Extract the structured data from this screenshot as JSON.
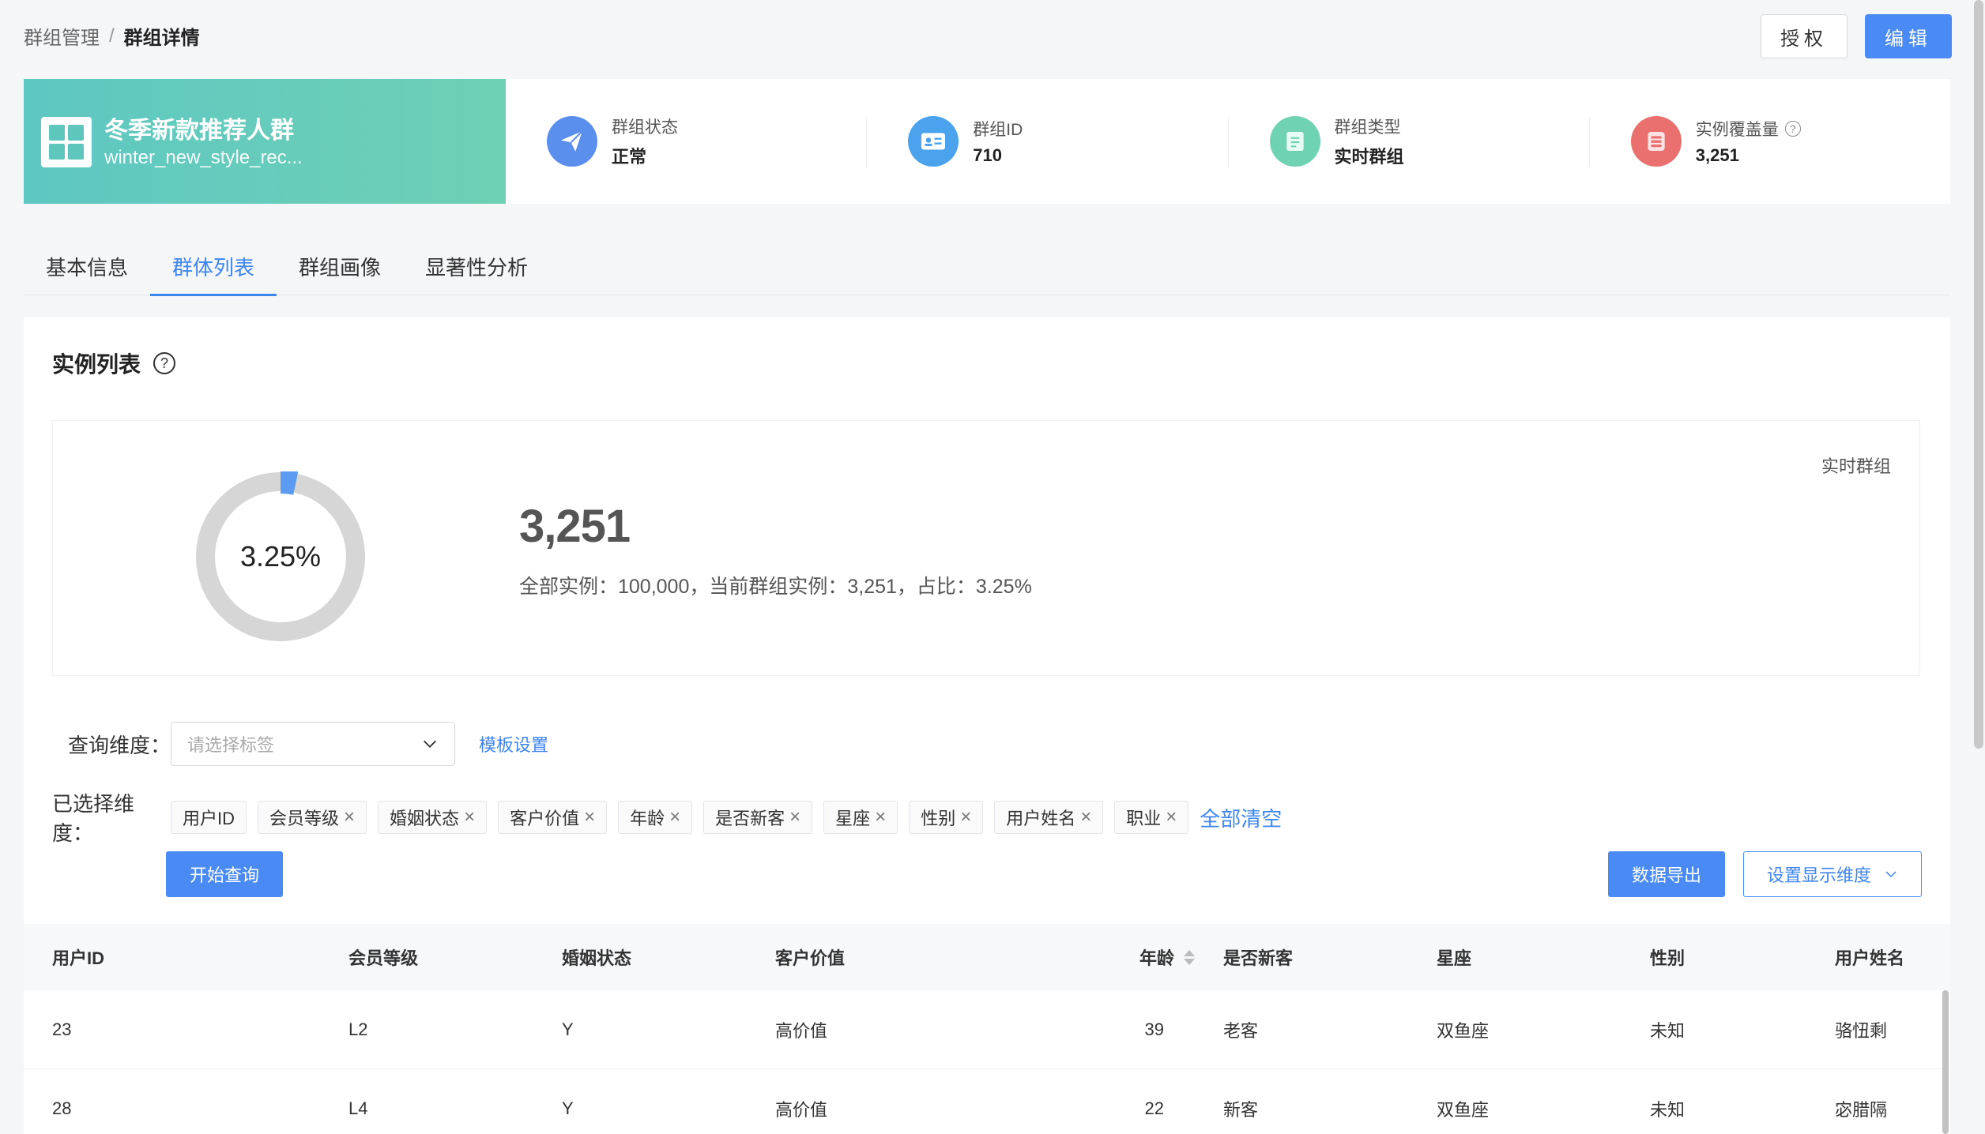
{
  "breadcrumb": {
    "parent": "群组管理",
    "separator": "/",
    "current": "群组详情"
  },
  "actions": {
    "authorize": "授权",
    "edit": "编辑"
  },
  "group": {
    "name": "冬季新款推荐人群",
    "code": "winter_new_style_rec..."
  },
  "stats": [
    {
      "label": "群组状态",
      "value": "正常",
      "icon": "paper-plane-icon",
      "color": "#5b8fee"
    },
    {
      "label": "群组ID",
      "value": "710",
      "icon": "id-card-icon",
      "color": "#4aa3ec"
    },
    {
      "label": "群组类型",
      "value": "实时群组",
      "icon": "document-icon",
      "color": "#6fd2b2"
    },
    {
      "label": "实例覆盖量",
      "value": "3,251",
      "icon": "server-icon",
      "color": "#ea6f6f"
    }
  ],
  "tabs": [
    "基本信息",
    "群体列表",
    "群组画像",
    "显著性分析"
  ],
  "active_tab": 1,
  "panel": {
    "title": "实例列表",
    "overview": {
      "percent": 3.25,
      "percent_label": "3.25%",
      "count": "3,251",
      "description": "全部实例：100,000，当前群组实例：3,251，占比：3.25%",
      "group_type": "实时群组"
    },
    "query": {
      "label": "查询维度：",
      "placeholder": "请选择标签",
      "template_link": "模板设置"
    },
    "selected": {
      "label": "已选择维度：",
      "chips": [
        {
          "label": "用户ID",
          "removable": false
        },
        {
          "label": "会员等级",
          "removable": true
        },
        {
          "label": "婚姻状态",
          "removable": true
        },
        {
          "label": "客户价值",
          "removable": true
        },
        {
          "label": "年龄",
          "removable": true
        },
        {
          "label": "是否新客",
          "removable": true
        },
        {
          "label": "星座",
          "removable": true
        },
        {
          "label": "性别",
          "removable": true
        },
        {
          "label": "用户姓名",
          "removable": true
        },
        {
          "label": "职业",
          "removable": true
        }
      ],
      "clear_all": "全部清空"
    },
    "buttons": {
      "start": "开始查询",
      "export": "数据导出",
      "display_dims": "设置显示维度"
    }
  },
  "table": {
    "columns": [
      "用户ID",
      "会员等级",
      "婚姻状态",
      "客户价值",
      "年龄",
      "是否新客",
      "星座",
      "性别",
      "用户姓名"
    ],
    "rows": [
      [
        "23",
        "L2",
        "Y",
        "高价值",
        "39",
        "老客",
        "双鱼座",
        "未知",
        "骆忸剩"
      ],
      [
        "28",
        "L4",
        "Y",
        "高价值",
        "22",
        "新客",
        "双鱼座",
        "未知",
        "宓腊隔"
      ]
    ]
  },
  "colors": {
    "primary": "#4a8af4",
    "donut_track": "#d6d6d6",
    "donut_fill": "#5b9cf2"
  }
}
